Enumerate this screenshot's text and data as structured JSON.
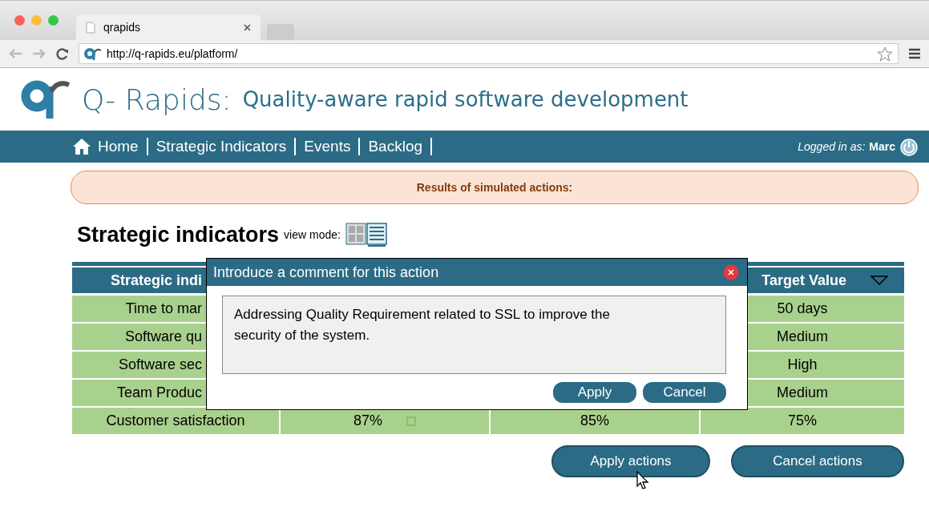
{
  "browser": {
    "tab_title": "qrapids",
    "url": "http://q-rapids.eu/platform/"
  },
  "header": {
    "brand": "Q- Rapids:",
    "tagline": "Quality-aware rapid software development"
  },
  "nav": {
    "items": [
      {
        "label": "Home",
        "kind": "home"
      },
      {
        "label": "Strategic Indicators",
        "kind": "plain"
      },
      {
        "label": "Events",
        "kind": "plain"
      },
      {
        "label": "Backlog",
        "kind": "plain"
      }
    ],
    "login_label": "Logged in as:",
    "user": "Marc"
  },
  "banner": "Results of  simulated actions:",
  "section": {
    "title": "Strategic indicators",
    "view_mode_label": "view mode:"
  },
  "table": {
    "columns": [
      {
        "label": "Strategic indi"
      },
      {
        "label": "Target Value"
      }
    ],
    "rows": [
      {
        "indicator": "Time to mar",
        "target": "50 days"
      },
      {
        "indicator": "Software qu",
        "target": "Medium"
      },
      {
        "indicator": "Software sec",
        "target": "High"
      },
      {
        "indicator": "Team Produc",
        "target": "Medium"
      },
      {
        "indicator": "Customer satisfaction",
        "column_2": "87%",
        "column_3": "85%",
        "target": "75%"
      }
    ]
  },
  "dialog": {
    "title": "Introduce a comment for this action",
    "comment": "Addressing Quality Requirement related to SSL to improve the security of the system.",
    "buttons": [
      "Apply",
      "Cancel"
    ]
  },
  "actions": [
    "Apply actions",
    "Cancel actions"
  ]
}
